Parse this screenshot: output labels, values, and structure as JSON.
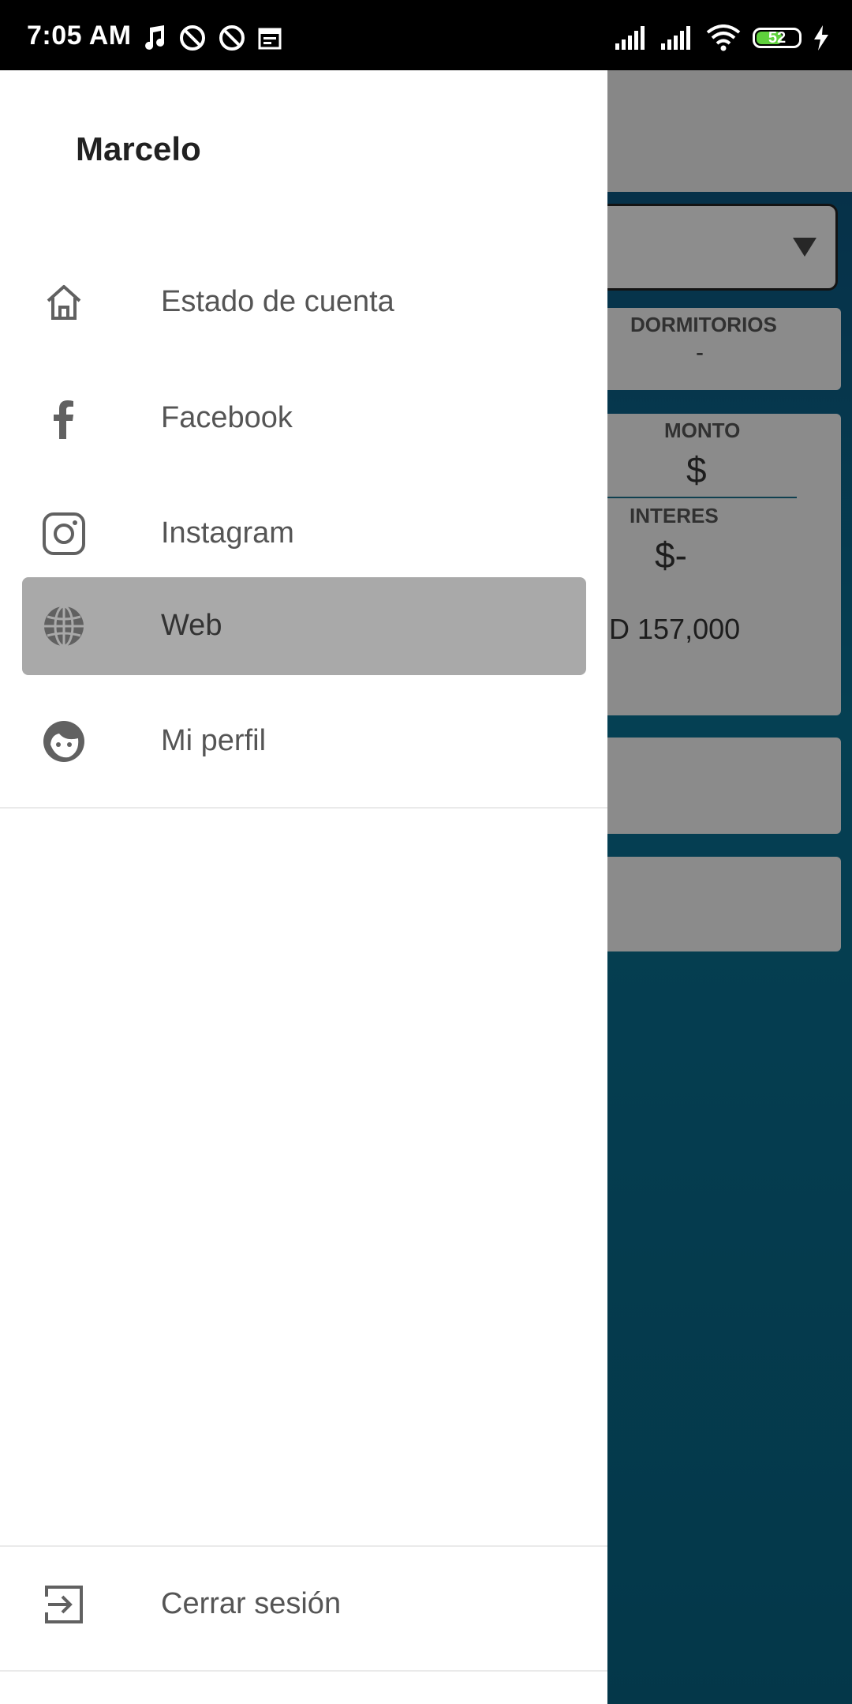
{
  "status_bar": {
    "time": "7:05 AM",
    "battery": "52"
  },
  "background_app": {
    "dormitorios_label": "DORMITORIOS",
    "dormitorios_value": "-",
    "monto_label": "MONTO",
    "monto_value": "$",
    "interes_label": "INTERES",
    "interes_value": "$-",
    "total_value": "D 157,000"
  },
  "drawer": {
    "user_name": "Marcelo",
    "items": [
      {
        "label": "Estado de cuenta",
        "icon": "home-icon"
      },
      {
        "label": "Facebook",
        "icon": "facebook-icon"
      },
      {
        "label": "Instagram",
        "icon": "instagram-icon"
      },
      {
        "label": "Web",
        "icon": "globe-icon",
        "selected": true
      },
      {
        "label": "Mi perfil",
        "icon": "profile-face-icon"
      }
    ],
    "logout_label": "Cerrar sesión",
    "logout_icon": "logout-icon"
  }
}
